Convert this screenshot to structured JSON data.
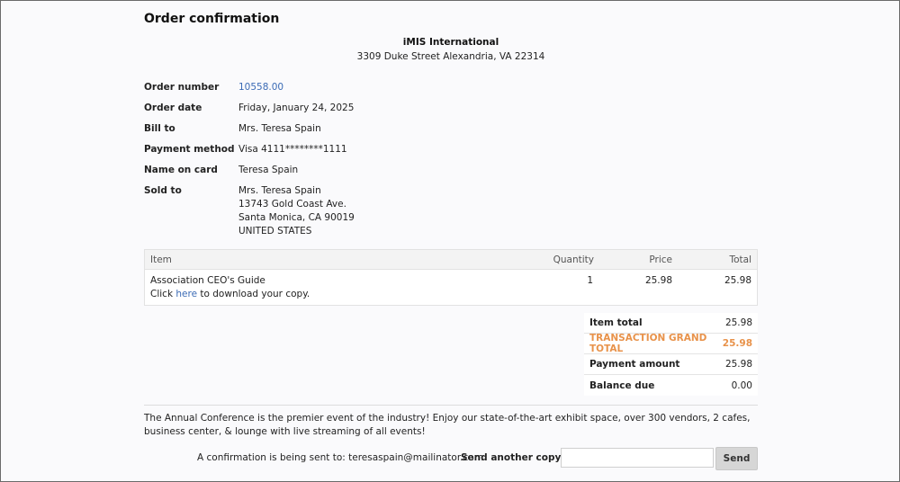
{
  "page": {
    "title": "Order confirmation"
  },
  "organization": {
    "name": "iMIS International",
    "address": "3309 Duke Street Alexandria, VA 22314"
  },
  "order": {
    "number_label": "Order number",
    "number": "10558.00",
    "date_label": "Order date",
    "date": "Friday, January 24, 2025",
    "bill_to_label": "Bill to",
    "bill_to": "Mrs. Teresa Spain",
    "payment_method_label": "Payment method",
    "payment_method": "Visa 4111********1111",
    "name_on_card_label": "Name on card",
    "name_on_card": "Teresa Spain",
    "sold_to_label": "Sold to",
    "sold_to": [
      "Mrs. Teresa Spain",
      "13743 Gold Coast Ave.",
      "Santa Monica, CA 90019",
      "UNITED STATES"
    ]
  },
  "items_table": {
    "headers": {
      "item": "Item",
      "quantity": "Quantity",
      "price": "Price",
      "total": "Total"
    },
    "rows": [
      {
        "item": "Association CEO's Guide",
        "quantity": "1",
        "price": "25.98",
        "total": "25.98",
        "note_prefix": "Click",
        "note_link": "here",
        "note_suffix": "to download your copy."
      }
    ]
  },
  "totals": {
    "item_total_label": "Item total",
    "item_total": "25.98",
    "grand_total_label": "TRANSACTION GRAND TOTAL",
    "grand_total": "25.98",
    "payment_amount_label": "Payment amount",
    "payment_amount": "25.98",
    "balance_due_label": "Balance due",
    "balance_due": "0.00"
  },
  "promo_text": "The Annual Conference is the premier event of the industry! Enjoy our state-of-the-art exhibit space, over 300 vendors, 2 cafes, business center, & lounge with live streaming of all events!",
  "confirmation": {
    "sent_text": "A confirmation is being sent to: teresaspain@mailinator.com",
    "send_copy_label": "Send another copy to",
    "email_value": "",
    "send_button": "Send"
  },
  "colors": {
    "link": "#3b6bb5",
    "grand_total": "#e8924a",
    "button_bg": "#d6d6d6"
  }
}
